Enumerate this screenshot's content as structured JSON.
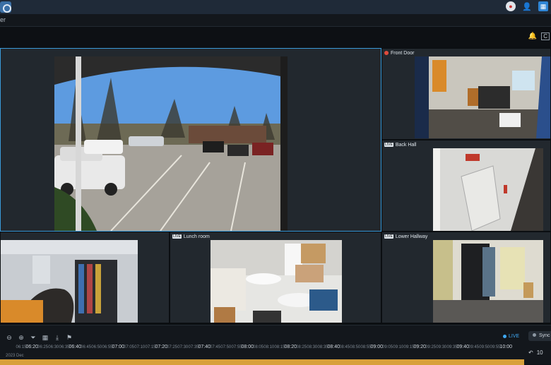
{
  "app": {
    "menu_label": "er"
  },
  "topbar": {
    "icons": [
      "notification-icon",
      "user-icon",
      "app-grid-icon"
    ]
  },
  "toolbar": {
    "icons": [
      "bell-icon",
      "layout-icon"
    ]
  },
  "cameras": {
    "main": {
      "label": ""
    },
    "front_door": {
      "label": "Front Door",
      "status": "recording"
    },
    "back_hall": {
      "label": "Back Hall",
      "badge": "LIVE"
    },
    "top_left": {
      "label": "",
      "badge": ""
    },
    "lunch_room": {
      "label": "Lunch room",
      "badge": "LIVE"
    },
    "lower_hallway": {
      "label": "Lower Hallway",
      "badge": "LIVE"
    }
  },
  "timeline": {
    "live_label": "LIVE",
    "sync_label": "Sync",
    "date_label": "2023 Dec",
    "step_value": "10",
    "ticks": [
      "06:15",
      "06:20",
      "06:25",
      "06:30",
      "06:35",
      "06:40",
      "06:45",
      "06:50",
      "06:55",
      "07:00",
      "07:05",
      "07:10",
      "07:15",
      "07:20",
      "07:25",
      "07:30",
      "07:35",
      "07:40",
      "07:45",
      "07:50",
      "07:55",
      "08:00",
      "08:05",
      "08:10",
      "08:15",
      "08:20",
      "08:25",
      "08:30",
      "08:35",
      "08:40",
      "08:45",
      "08:50",
      "08:55",
      "09:00",
      "09:05",
      "09:10",
      "09:15",
      "09:20",
      "09:25",
      "09:30",
      "09:35",
      "09:40",
      "09:45",
      "09:50",
      "09:55",
      "10:00"
    ],
    "major_ticks": [
      "06:20",
      "06:40",
      "07:00",
      "07:20",
      "07:40",
      "08:00",
      "08:20",
      "08:40",
      "09:00",
      "09:20",
      "09:40",
      "10:00"
    ]
  }
}
